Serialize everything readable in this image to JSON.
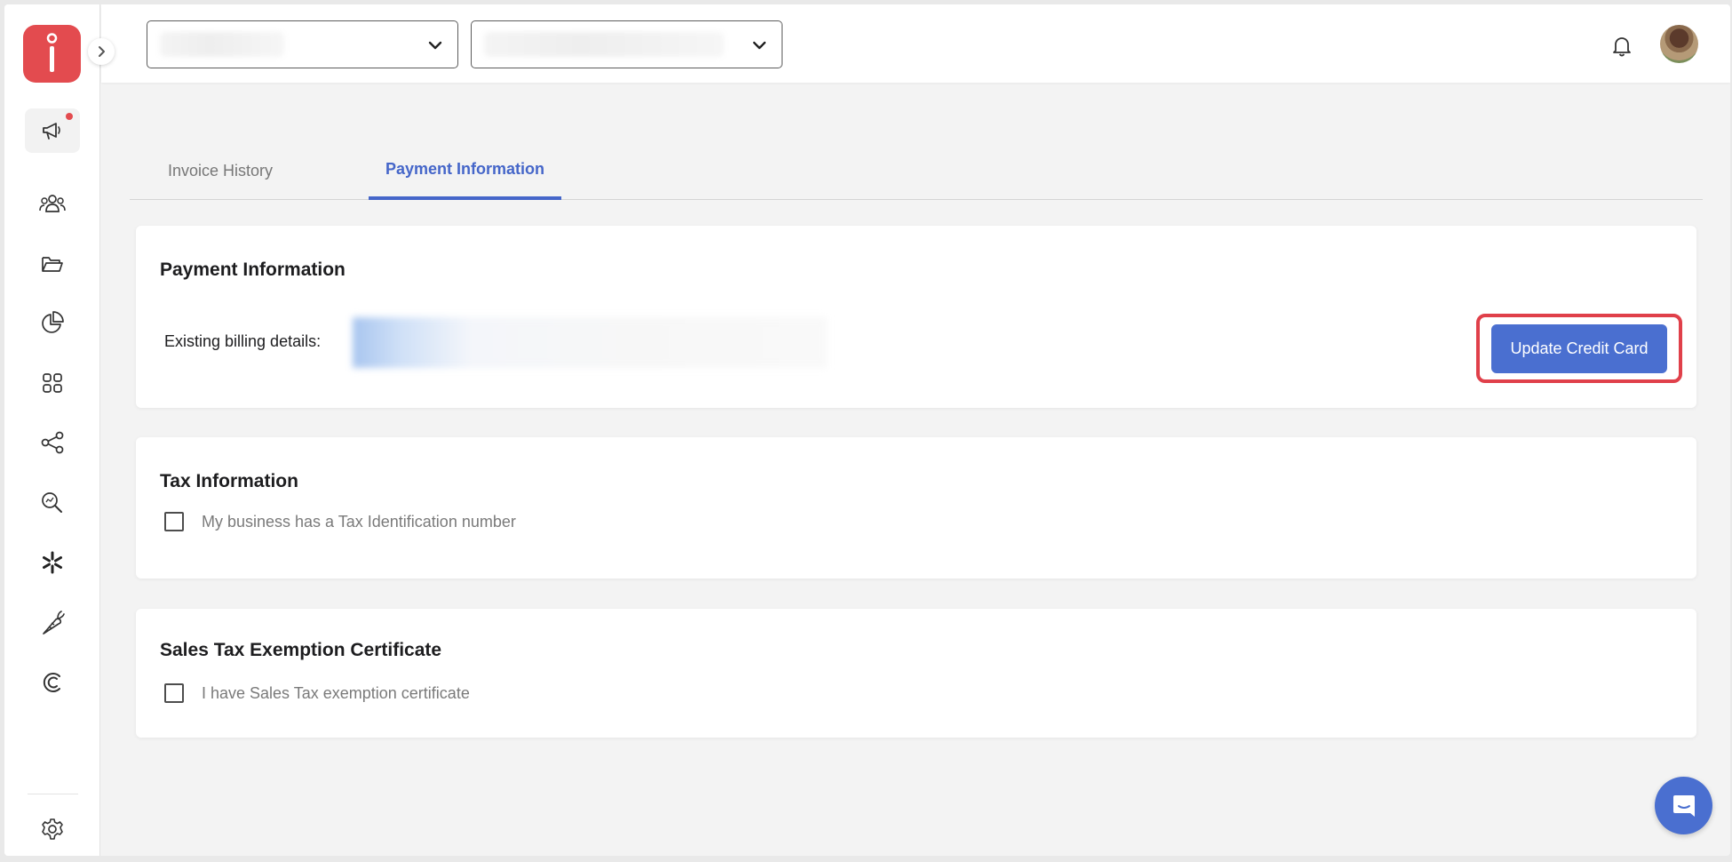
{
  "sidebar": {
    "logo": "logo-icon",
    "expand": "chevron-right-icon",
    "items": [
      {
        "icon": "megaphone-icon",
        "name": "announcements",
        "has_notification": true,
        "active": true
      },
      {
        "icon": "users-icon",
        "name": "users"
      },
      {
        "icon": "folder-icon",
        "name": "folders"
      },
      {
        "icon": "pie-chart-icon",
        "name": "analytics"
      },
      {
        "icon": "apps-grid-icon",
        "name": "apps"
      },
      {
        "icon": "share-icon",
        "name": "share"
      },
      {
        "icon": "search-analytics-icon",
        "name": "search"
      },
      {
        "icon": "sparkle-icon",
        "name": "integrations"
      },
      {
        "icon": "carrot-icon",
        "name": "carrot"
      },
      {
        "icon": "c-logo-icon",
        "name": "c-integration"
      },
      {
        "icon": "gear-icon",
        "name": "settings"
      }
    ]
  },
  "topbar": {
    "dropdown_1": {
      "value": ""
    },
    "dropdown_2": {
      "value": ""
    },
    "notification_icon": "bell-icon",
    "avatar": "user-avatar"
  },
  "tabs": [
    {
      "label": "Invoice History",
      "active": false
    },
    {
      "label": "Payment Information",
      "active": true
    }
  ],
  "payment_card": {
    "title": "Payment Information",
    "billing_label": "Existing billing details:",
    "billing_value": "",
    "update_button": "Update Credit Card"
  },
  "tax_card": {
    "title": "Tax Information",
    "checkbox_label": "My business has a Tax Identification number",
    "checked": false
  },
  "exemption_card": {
    "title": "Sales Tax Exemption Certificate",
    "checkbox_label": "I have Sales Tax exemption certificate",
    "checked": false
  },
  "colors": {
    "accent": "#4a6fd0",
    "tab_active": "#4566c9",
    "brand": "#e34b4f",
    "highlight": "#e0404a"
  },
  "chat_widget": "chat-icon"
}
